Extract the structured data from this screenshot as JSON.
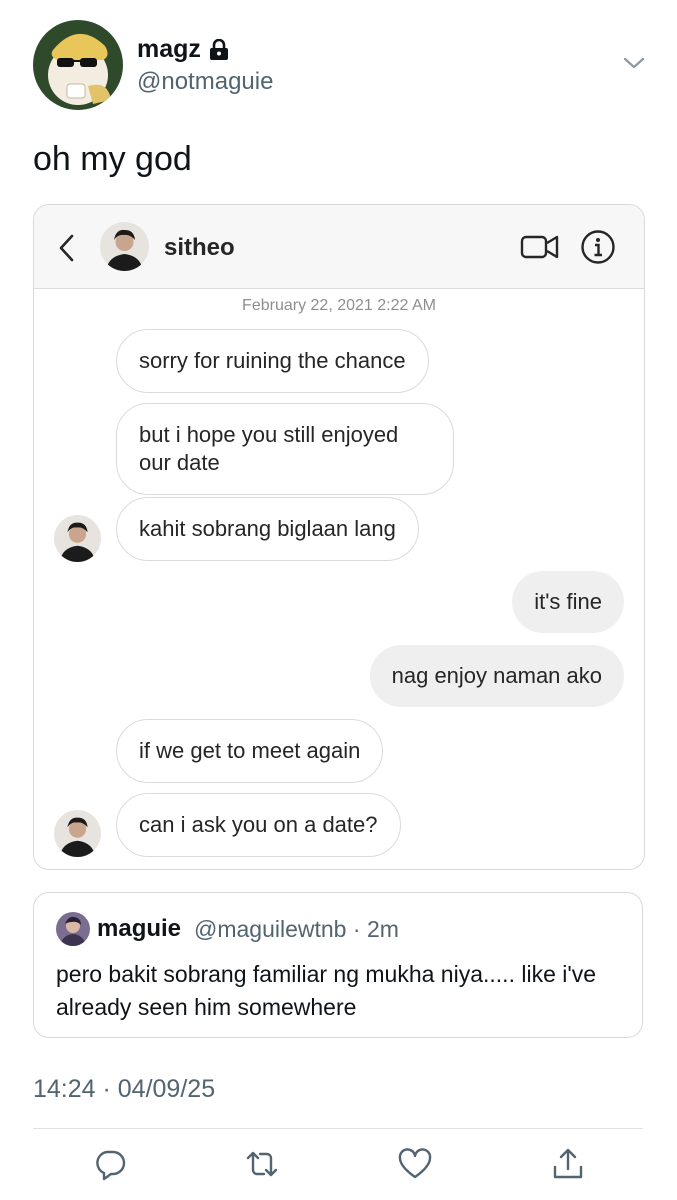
{
  "author": {
    "display_name": "magz",
    "handle": "@notmaguie",
    "avatar_icon": "cat-avatar",
    "locked_icon": "lock-icon"
  },
  "tweet": {
    "text": "oh my god",
    "timestamp": "14:24 · 04/09/25"
  },
  "dm": {
    "contact_name": "sitheo",
    "date": "February 22, 2021 2:22 AM",
    "messages": [
      {
        "side": "in",
        "text": "sorry for ruining the chance"
      },
      {
        "side": "in",
        "text": "but i hope you still enjoyed our date"
      },
      {
        "side": "in",
        "text": "kahit sobrang biglaan lang"
      },
      {
        "side": "out",
        "text": "it's fine"
      },
      {
        "side": "out",
        "text": "nag enjoy naman ako"
      },
      {
        "side": "in",
        "text": "if we get to meet again"
      },
      {
        "side": "in",
        "text": "can i ask you on a date?"
      }
    ]
  },
  "quote": {
    "name": "maguie",
    "handle": "@maguilewtnb",
    "time": "2m",
    "text": "pero bakit sobrang familiar ng mukha niya..... like i've already seen him somewhere"
  },
  "icons": {
    "reply": "reply-icon",
    "retweet": "retweet-icon",
    "like": "heart-icon",
    "share": "share-icon"
  },
  "colors": {
    "secondary_text": "#536471",
    "bubble_out": "#efefef",
    "bubble_border": "#dbdbdb"
  }
}
